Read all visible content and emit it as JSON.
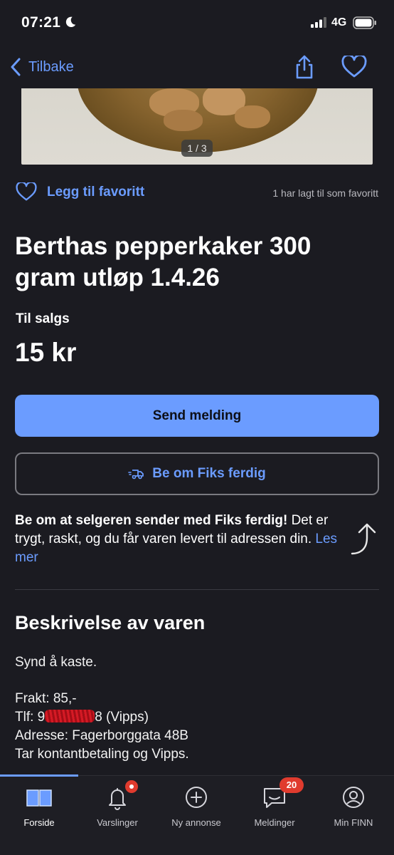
{
  "status_bar": {
    "time": "07:21",
    "network": "4G"
  },
  "nav": {
    "back_label": "Tilbake"
  },
  "photo": {
    "counter": "1 / 3"
  },
  "favorite": {
    "label": "Legg til favoritt",
    "count_text": "1 har lagt til som favoritt"
  },
  "listing": {
    "title": "Berthas pepperkaker 300 gram utløp 1.4.26",
    "sale_label": "Til salgs",
    "price": "15 kr"
  },
  "actions": {
    "send_message": "Send melding",
    "fiks_ferdig": "Be om Fiks ferdig"
  },
  "fiks_info": {
    "bold": "Be om at selgeren sender med Fiks ferdig!",
    "text": " Det er trygt, raskt, og du får varen levert til adressen din.",
    "link": "Les mer"
  },
  "description": {
    "heading": "Beskrivelse av varen",
    "line1": "Synd å kaste.",
    "line2": "Frakt: 85,-",
    "phone_prefix": "Tlf: 9",
    "phone_suffix": "8 (Vipps)",
    "line4": "Adresse: Fagerborggata 48B",
    "line5": "Tar kontantbetaling og Vipps."
  },
  "tabbar": {
    "tabs": [
      {
        "label": "Forside",
        "icon": "book-icon",
        "active": true
      },
      {
        "label": "Varslinger",
        "icon": "bell-icon"
      },
      {
        "label": "Ny annonse",
        "icon": "plus-circle-icon"
      },
      {
        "label": "Meldinger",
        "icon": "chat-icon",
        "badge": "20"
      },
      {
        "label": "Min FINN",
        "icon": "profile-icon"
      }
    ]
  },
  "colors": {
    "background": "#1b1b21",
    "accent": "#6b9cff",
    "badge": "#e03b2e"
  }
}
